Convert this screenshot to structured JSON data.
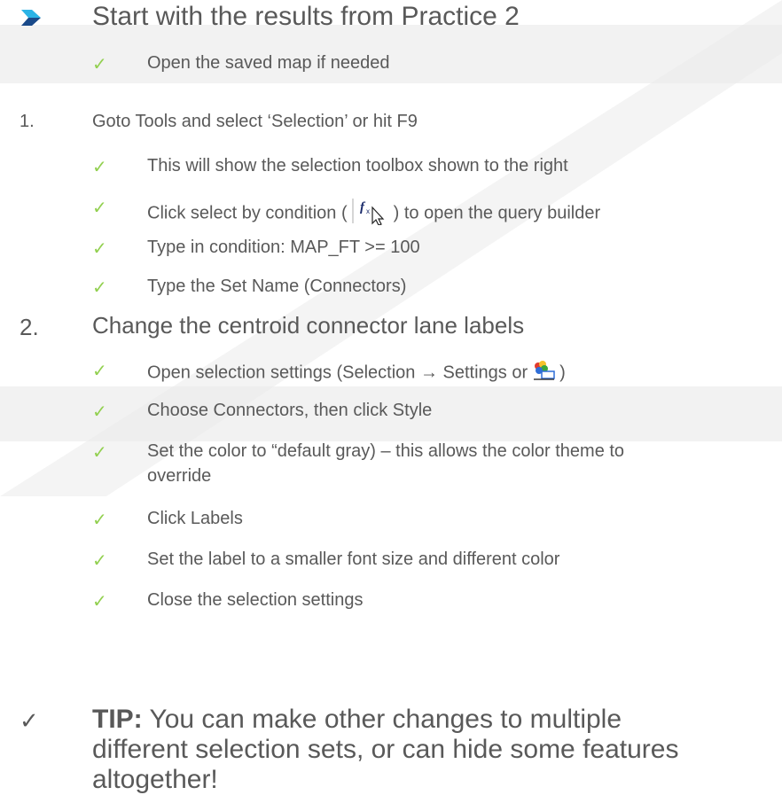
{
  "title": "Start with the results from Practice 2",
  "intro_items": [
    "Open the saved map if needed"
  ],
  "step1": {
    "number": "1.",
    "heading": "Goto Tools and select ‘Selection’ or hit F9",
    "items": [
      "This will show the selection toolbox shown to the right",
      "Click select by condition (",
      ") to open the query builder",
      "Type in condition: MAP_FT >= 100",
      "Type the Set Name (Connectors)"
    ]
  },
  "step2": {
    "number": "2.",
    "heading": "Change the centroid connector lane labels",
    "items": [
      "Open selection settings (Selection → Settings or",
      ")",
      "Choose Connectors, then click Style",
      "Set the color to “default gray) – this allows the color theme to",
      "override",
      "Click Labels",
      "Set the label to a smaller font size and different color",
      "Close the selection settings"
    ]
  },
  "tip": {
    "label": "TIP:",
    "text": " You can make other changes to multiple different selection sets, or can hide some features altogether!"
  },
  "colors": {
    "text": "#595959",
    "check": "#92d050",
    "arrow_dark": "#1a4a8a",
    "arrow_light": "#2bb3e6"
  },
  "icons": {
    "bullet": "arrow-chevron-icon",
    "check": "checkmark-icon",
    "condition_select": "fx-cursor-icon",
    "settings": "selection-settings-icon"
  }
}
